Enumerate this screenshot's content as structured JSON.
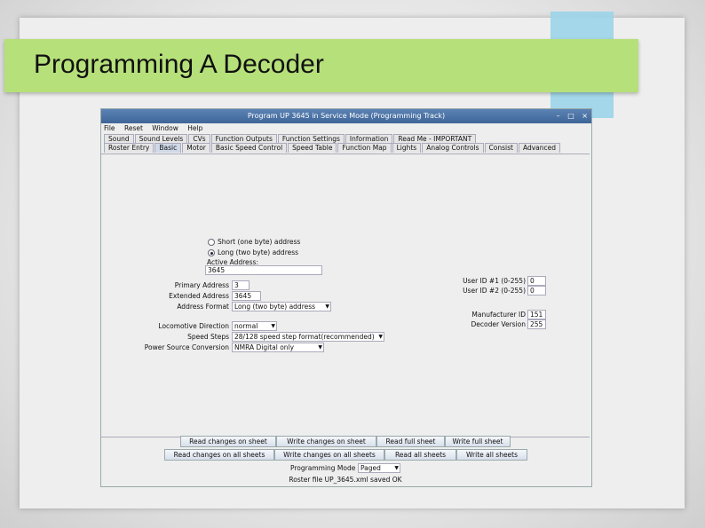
{
  "slide": {
    "title": "Programming A Decoder"
  },
  "window": {
    "title": "Program UP 3645 in Service Mode (Programming Track)",
    "controls": [
      "–",
      "□",
      "×"
    ]
  },
  "menu": [
    "File",
    "Reset",
    "Window",
    "Help"
  ],
  "tabs_row1": [
    "Sound",
    "Sound Levels",
    "CVs",
    "Function Outputs",
    "Function Settings",
    "Information",
    "Read Me - IMPORTANT"
  ],
  "tabs_row2": [
    "Roster Entry",
    "Basic",
    "Motor",
    "Basic Speed Control",
    "Speed Table",
    "Function Map",
    "Lights",
    "Analog Controls",
    "Consist",
    "Advanced"
  ],
  "basic": {
    "short_address_label": "Short (one byte) address",
    "long_address_label": "Long (two byte) address",
    "active_address_label": "Active Address:",
    "active_address_value": "3645",
    "primary_address_label": "Primary Address",
    "primary_address_value": "3",
    "extended_address_label": "Extended Address",
    "extended_address_value": "3645",
    "address_format_label": "Address Format",
    "address_format_value": "Long (two byte) address",
    "loco_direction_label": "Locomotive Direction",
    "loco_direction_value": "normal",
    "speed_steps_label": "Speed Steps",
    "speed_steps_value": "28/128 speed step format(recommended)",
    "power_source_label": "Power Source Conversion",
    "power_source_value": "NMRA Digital only",
    "user_id1_label": "User ID #1 (0-255)",
    "user_id1_value": "0",
    "user_id2_label": "User ID #2 (0-255)",
    "user_id2_value": "0",
    "manufacturer_label": "Manufacturer ID",
    "manufacturer_value": "151",
    "decoder_version_label": "Decoder Version",
    "decoder_version_value": "255"
  },
  "buttons_row1": [
    "Read changes on sheet",
    "Write changes on sheet",
    "Read full sheet",
    "Write full sheet"
  ],
  "buttons_row2": [
    "Read changes on all sheets",
    "Write changes on all sheets",
    "Read all sheets",
    "Write all sheets"
  ],
  "programming_mode_label": "Programming Mode",
  "programming_mode_value": "Paged",
  "status": "Roster file UP_3645.xml saved OK"
}
